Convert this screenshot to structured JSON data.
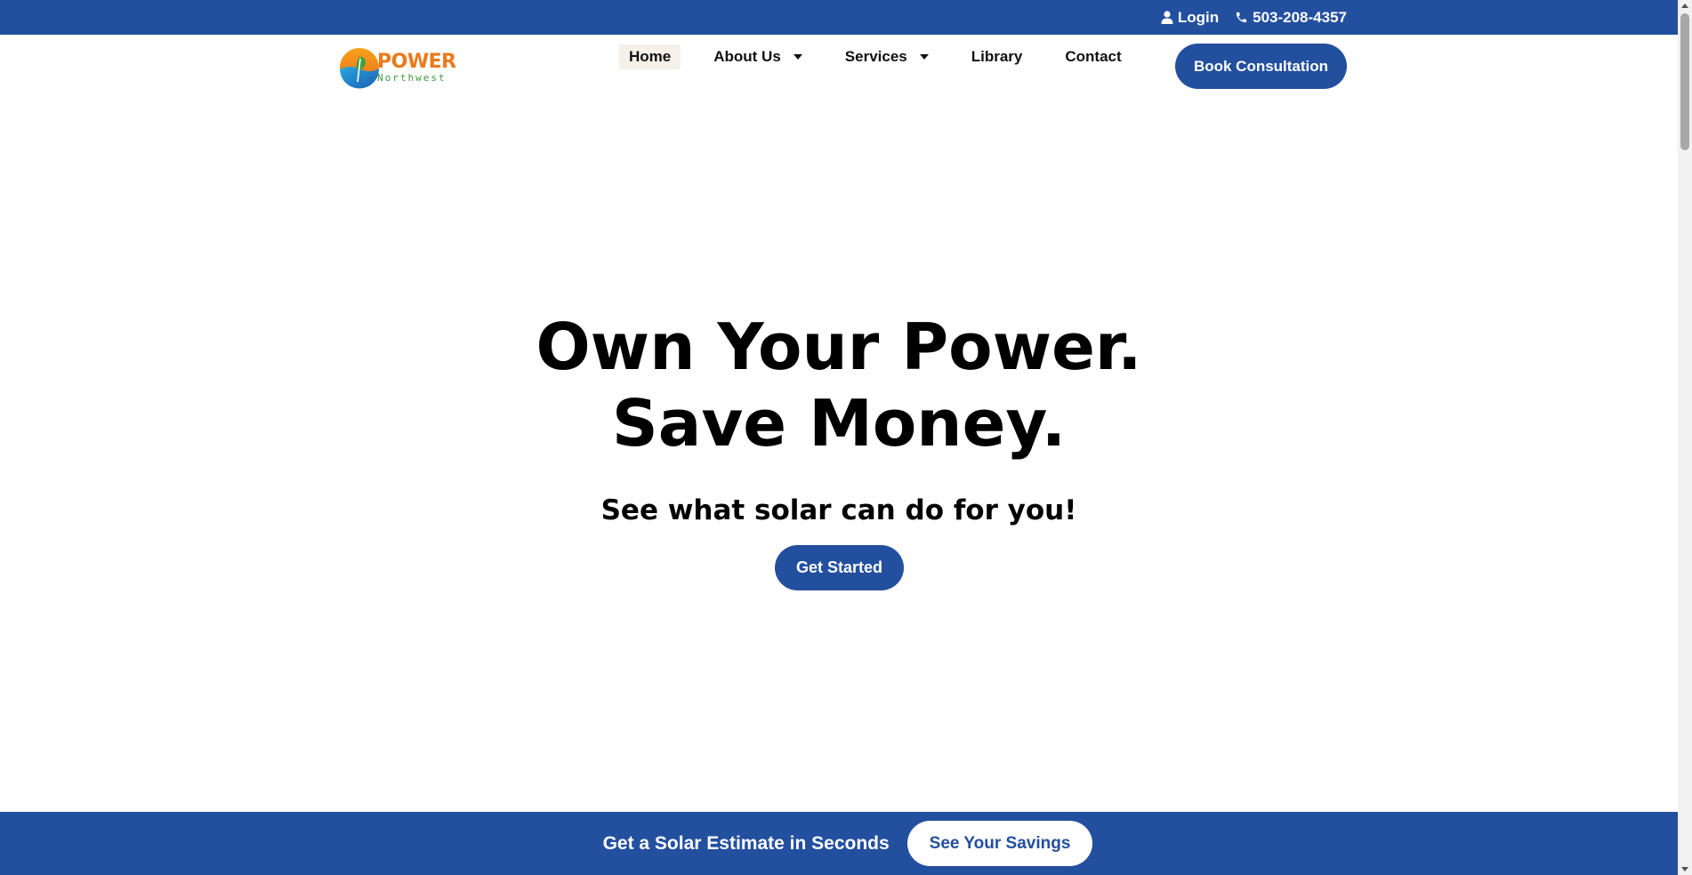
{
  "topbar": {
    "login_label": "Login",
    "phone": "503-208-4357"
  },
  "logo": {
    "word": "POWER",
    "subword": "Northwest"
  },
  "nav": {
    "items": [
      {
        "label": "Home",
        "active": true
      },
      {
        "label": "About Us",
        "dropdown": true
      },
      {
        "label": "Services",
        "dropdown": true
      },
      {
        "label": "Library"
      },
      {
        "label": "Contact"
      }
    ],
    "cta_label": "Book Consultation"
  },
  "hero": {
    "title_line1": "Own Your Power.",
    "title_line2": "Save Money.",
    "subtitle": "See what solar can do for you!",
    "button_label": "Get Started"
  },
  "banner": {
    "text": "Get a Solar Estimate in Seconds",
    "button_label": "See Your Savings"
  },
  "colors": {
    "brand_blue": "#234f9f",
    "logo_orange": "#ea7a1c",
    "logo_green": "#3a9a3a"
  }
}
